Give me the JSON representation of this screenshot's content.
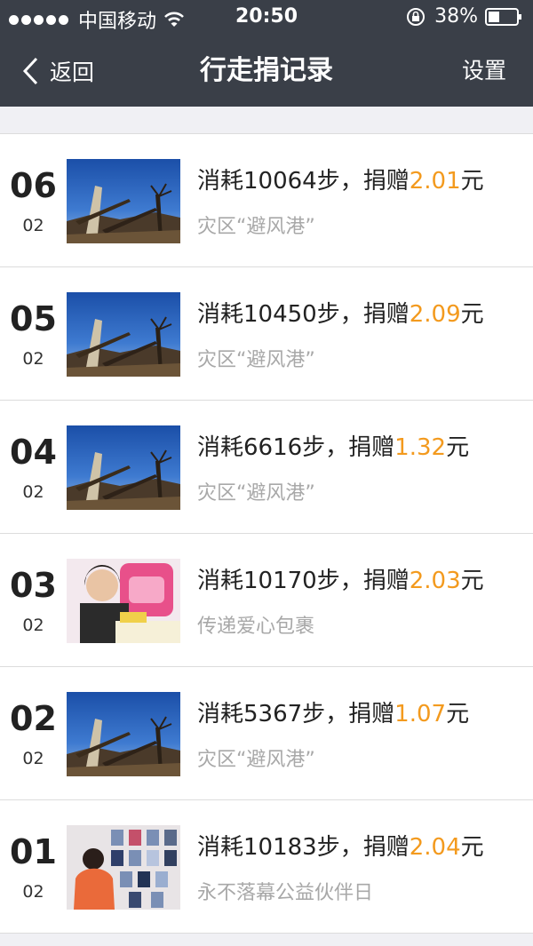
{
  "statusbar": {
    "carrier": "中国移动",
    "time": "20:50",
    "battery": "38%"
  },
  "nav": {
    "back_label": "返回",
    "title": "行走捐记录",
    "settings_label": "设置"
  },
  "records": [
    {
      "day": "06",
      "month": "02",
      "t1": "消耗10064步，捐赠",
      "amount": "2.01",
      "unit": "元",
      "project": "灾区“避风港”",
      "image": "disaster-photo"
    },
    {
      "day": "05",
      "month": "02",
      "t1": "消耗10450步，捐赠",
      "amount": "2.09",
      "unit": "元",
      "project": "灾区“避风港”",
      "image": "disaster-photo"
    },
    {
      "day": "04",
      "month": "02",
      "t1": "消耗6616步，捐赠",
      "amount": "1.32",
      "unit": "元",
      "project": "灾区“避风港”",
      "image": "disaster-photo"
    },
    {
      "day": "03",
      "month": "02",
      "t1": "消耗10170步，捐赠",
      "amount": "2.03",
      "unit": "元",
      "project": "传递爱心包裹",
      "image": "child-backpack-photo"
    },
    {
      "day": "02",
      "month": "02",
      "t1": "消耗5367步，捐赠",
      "amount": "1.07",
      "unit": "元",
      "project": "灾区“避风港”",
      "image": "disaster-photo"
    },
    {
      "day": "01",
      "month": "02",
      "t1": "消耗10183步，捐赠",
      "amount": "2.04",
      "unit": "元",
      "project": "永不落幕公益伙伴日",
      "image": "photo-wall-photo"
    }
  ],
  "colors": {
    "bar": "#3a3f48",
    "accent": "#f39a1e"
  }
}
